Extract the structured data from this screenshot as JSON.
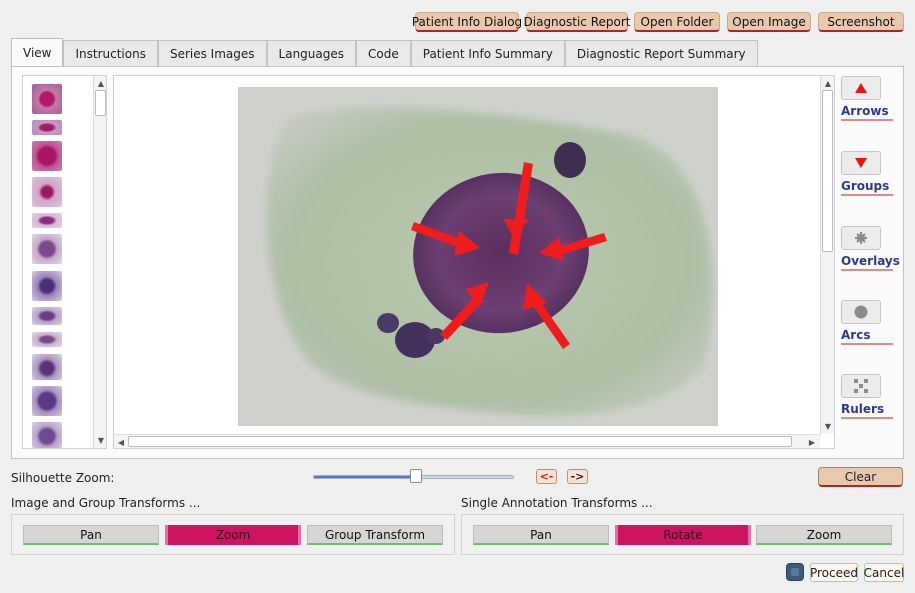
{
  "toolbar": {
    "patient_info_dialog": "Patient Info Dialog",
    "diagnostic_report": "Diagnostic Report",
    "open_folder": "Open Folder",
    "open_image": "Open Image",
    "screenshot": "Screenshot"
  },
  "tabs": [
    "View",
    "Instructions",
    "Series Images",
    "Languages",
    "Code",
    "Patient Info Summary",
    "Diagnostic Report Summary"
  ],
  "tools": {
    "arrows": "Arrows",
    "groups": "Groups",
    "overlays": "Overlays",
    "arcs": "Arcs",
    "rulers": "Rulers"
  },
  "zoom": {
    "label": "Silhouette Zoom:",
    "value_fraction": 0.51,
    "prev_label": "<-",
    "next_label": "->",
    "clear": "Clear"
  },
  "transforms": {
    "image_group_title": "Image and Group Transforms ...",
    "image_group_buttons": [
      "Pan",
      "Zoom",
      "Group Transform"
    ],
    "single_title": "Single Annotation Transforms ...",
    "single_buttons": [
      "Pan",
      "Rotate",
      "Zoom"
    ]
  },
  "footer": {
    "proceed": "Proceed",
    "cancel": "Cancel"
  },
  "colors": {
    "accent_button": "#e8c9ad",
    "active_transform": "#cc1460",
    "tool_label": "#2f3a8f",
    "arrow_red": "#f01c1c"
  }
}
